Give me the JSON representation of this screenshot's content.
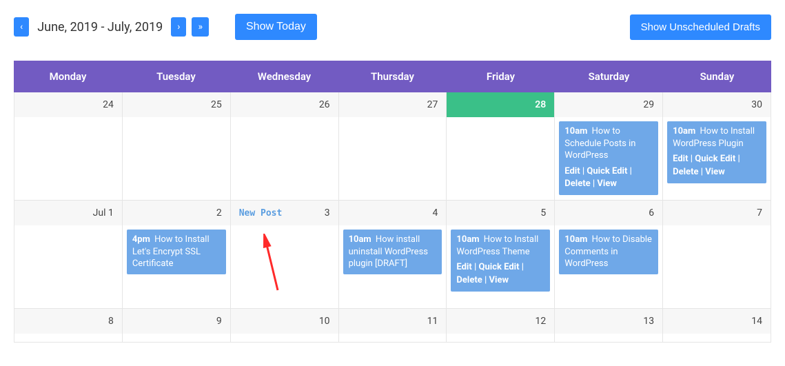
{
  "toolbar": {
    "prev": "‹",
    "next": "›",
    "next_fast": "»",
    "date_range": "June, 2019 - July, 2019",
    "show_today": "Show Today",
    "show_drafts": "Show Unscheduled Drafts"
  },
  "weekdays": [
    "Monday",
    "Tuesday",
    "Wednesday",
    "Thursday",
    "Friday",
    "Saturday",
    "Sunday"
  ],
  "new_post_label": "New Post",
  "action_labels": {
    "edit": "Edit",
    "quick_edit": "Quick Edit",
    "delete": "Delete",
    "view": "View"
  },
  "weeks": [
    {
      "days": [
        {
          "label": "24",
          "events": []
        },
        {
          "label": "25",
          "events": []
        },
        {
          "label": "26",
          "events": []
        },
        {
          "label": "27",
          "events": []
        },
        {
          "label": "28",
          "today": true,
          "events": []
        },
        {
          "label": "29",
          "events": [
            {
              "time": "10am",
              "title": "How to Schedule Posts in WordPress",
              "actions": true
            }
          ]
        },
        {
          "label": "30",
          "events": [
            {
              "time": "10am",
              "title": "How to Install WordPress Plugin",
              "actions": true
            }
          ]
        }
      ]
    },
    {
      "days": [
        {
          "label": "Jul 1",
          "events": []
        },
        {
          "label": "2",
          "events": [
            {
              "time": "4pm",
              "title": "How to Install Let's Encrypt SSL Certificate",
              "actions": false
            }
          ]
        },
        {
          "label": "3",
          "hover": true,
          "events": []
        },
        {
          "label": "4",
          "events": [
            {
              "time": "10am",
              "title": "How install uninstall WordPress plugin [DRAFT]",
              "actions": false
            }
          ]
        },
        {
          "label": "5",
          "events": [
            {
              "time": "10am",
              "title": "How to Install WordPress Theme",
              "actions": true
            }
          ]
        },
        {
          "label": "6",
          "events": [
            {
              "time": "10am",
              "title": "How to Disable Comments in WordPress",
              "actions": false
            }
          ]
        },
        {
          "label": "7",
          "events": []
        }
      ]
    },
    {
      "short": true,
      "days": [
        {
          "label": "8",
          "events": []
        },
        {
          "label": "9",
          "events": []
        },
        {
          "label": "10",
          "events": []
        },
        {
          "label": "11",
          "events": []
        },
        {
          "label": "12",
          "events": []
        },
        {
          "label": "13",
          "events": []
        },
        {
          "label": "14",
          "events": []
        }
      ]
    }
  ],
  "colors": {
    "primary": "#2e89ff",
    "header": "#725bc2",
    "today": "#3ac088",
    "event": "#6fa8e8"
  }
}
